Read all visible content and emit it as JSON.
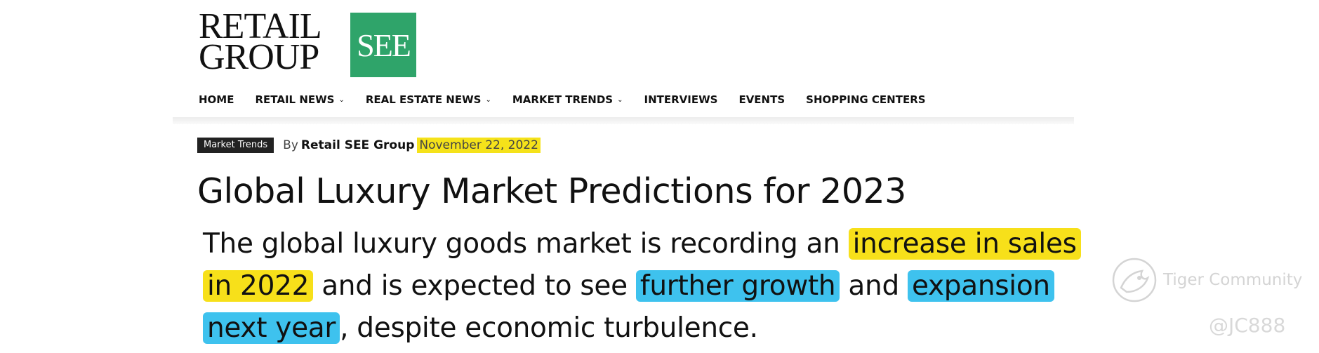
{
  "logo": {
    "line1": "RETAIL",
    "line2": "GROUP",
    "box_text": "SEE",
    "box_color": "#2fa46a"
  },
  "nav": [
    {
      "label": "HOME",
      "dropdown": false
    },
    {
      "label": "RETAIL NEWS",
      "dropdown": true
    },
    {
      "label": "REAL ESTATE NEWS",
      "dropdown": true
    },
    {
      "label": "MARKET TRENDS",
      "dropdown": true
    },
    {
      "label": "INTERVIEWS",
      "dropdown": false
    },
    {
      "label": "EVENTS",
      "dropdown": false
    },
    {
      "label": "SHOPPING CENTERS",
      "dropdown": false
    }
  ],
  "article": {
    "category": "Market Trends",
    "by": "By",
    "author": "Retail SEE Group",
    "date": "November 22, 2022",
    "title": "Global Luxury Market Predictions for 2023",
    "body": {
      "l1_a": "The global luxury goods market is recording an ",
      "l1_hl": "increase in sales",
      "l2_hl": "in 2022",
      "l2_b": " and is expected to see ",
      "l2_hl2": "further growth",
      "l2_c": " and ",
      "l2_hl3": "expansion",
      "l3_hl": "next year",
      "l3_b": ", despite economic turbulence."
    }
  },
  "highlight_colors": {
    "yellow": "#f7e01a",
    "blue": "#3ec2ee"
  },
  "watermark": {
    "icon": "tiger-community-icon",
    "text": "Tiger Community",
    "handle": "@JC888"
  }
}
